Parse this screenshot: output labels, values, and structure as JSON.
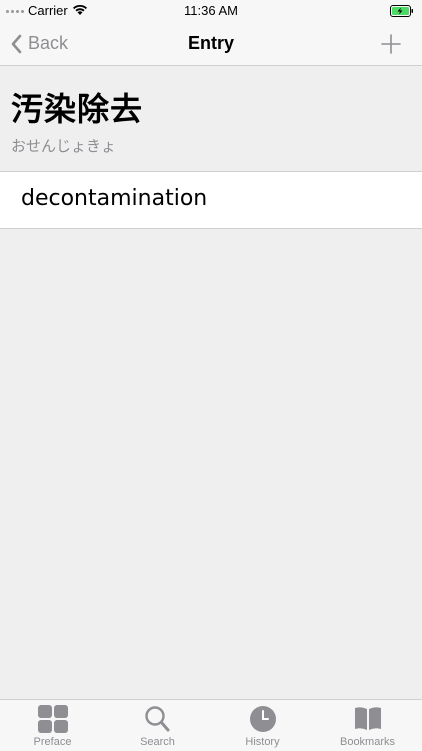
{
  "status_bar": {
    "carrier": "Carrier",
    "time": "11:36 AM"
  },
  "nav": {
    "back_label": "Back",
    "title": "Entry"
  },
  "entry": {
    "headword": "汚染除去",
    "reading": "おせんじょきょ",
    "meanings": [
      "decontamination"
    ]
  },
  "tabs": [
    {
      "label": "Preface",
      "icon": "grid-icon"
    },
    {
      "label": "Search",
      "icon": "search-icon"
    },
    {
      "label": "History",
      "icon": "clock-icon"
    },
    {
      "label": "Bookmarks",
      "icon": "book-icon"
    }
  ],
  "colors": {
    "accent_gray": "#8e8e93",
    "background": "#efefef",
    "battery_green": "#4cd964"
  }
}
